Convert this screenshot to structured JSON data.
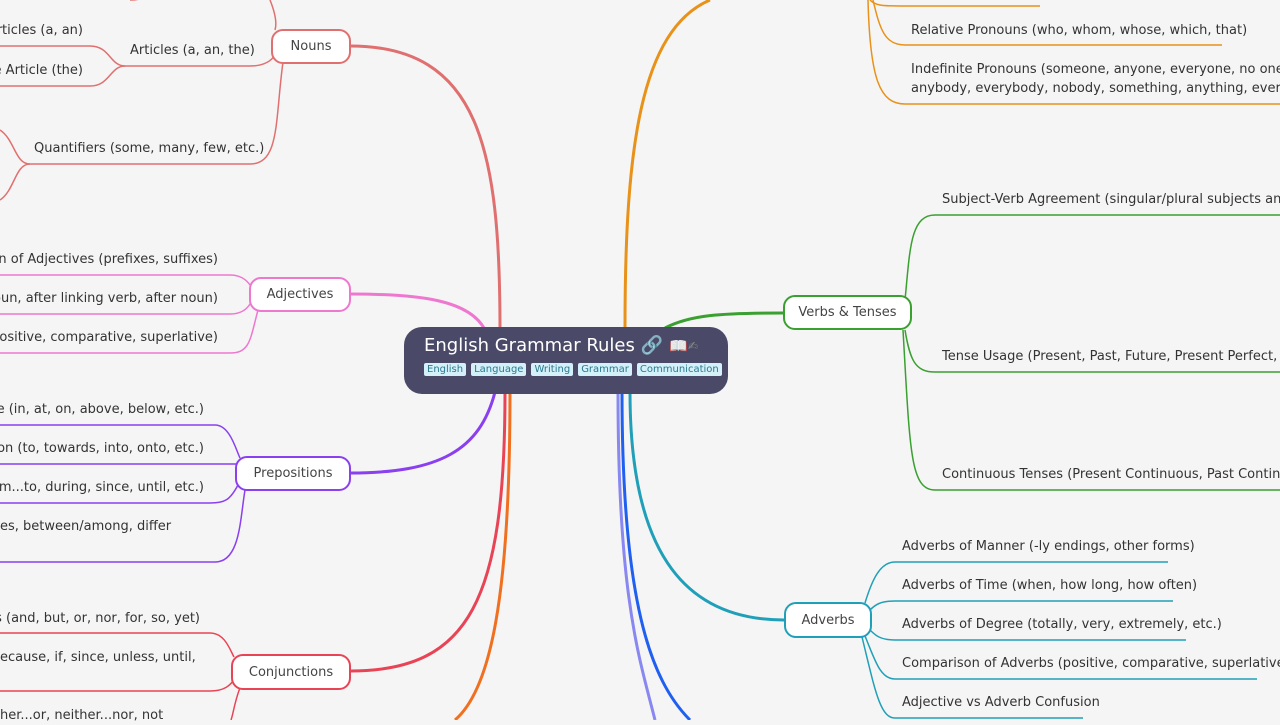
{
  "root": {
    "title": "English Grammar Rules",
    "icons": [
      "link-icon",
      "book-icon",
      "pencil-icon"
    ],
    "tags": [
      "English",
      "Language",
      "Writing",
      "Grammar",
      "Communication"
    ]
  },
  "branches": {
    "nouns": {
      "label": "Nouns",
      "color": "#e07070",
      "items": [
        "Articles (a, an)",
        "Articles (a, an, the)",
        "te Article (the)",
        "Quantifiers (some, many, few, etc.)"
      ]
    },
    "adjectives": {
      "label": "Adjectives",
      "color": "#ee78d0",
      "items": [
        "ation of Adjectives (prefixes, suffixes)",
        "e noun, after linking verb, after noun)",
        "s (positive, comparative, superlative)"
      ]
    },
    "prepositions": {
      "label": "Prepositions",
      "color": "#8a3ff0",
      "items": [
        "Place (in, at, on, above, below, etc.)",
        "ection (to, towards, into, onto, etc.)",
        " from...to, during, since, until, etc.)",
        "es, between/among, differ"
      ]
    },
    "conjunctions": {
      "label": "Conjunctions",
      "color": "#e84455",
      "items": [
        "tions (and, but, or, nor, for, so, yet)",
        "ecause, if, since, unless, until,",
        "her...or, neither...nor, not"
      ]
    },
    "pronouns": {
      "color": "#e8921a",
      "items": [
        "Relative Pronouns (who, whom, whose, which, that)",
        "Indefinite Pronouns (someone, anyone, everyone, no one, som",
        "anybody, everybody, nobody, something, anything, everything"
      ]
    },
    "verbs": {
      "label": "Verbs & Tenses",
      "color": "#3aa030",
      "items": [
        "Subject-Verb Agreement (singular/plural subjects and ver",
        "Tense Usage (Present, Past, Future, Present Perfect, Past",
        "Continuous Tenses (Present Continuous, Past Continuou"
      ]
    },
    "adverbs": {
      "label": "Adverbs",
      "color": "#20a0b8",
      "items": [
        "Adverbs of Manner (-ly endings, other forms)",
        "Adverbs of Time (when, how long, how often)",
        "Adverbs of Degree (totally, very, extremely, etc.)",
        "Comparison of Adverbs (positive, comparative, superlative)",
        "Adjective vs Adverb Confusion"
      ]
    }
  }
}
